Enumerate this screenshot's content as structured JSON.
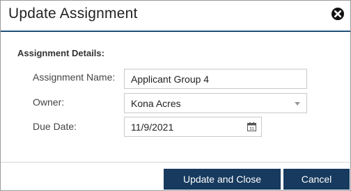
{
  "dialog": {
    "title": "Update Assignment"
  },
  "form": {
    "section_label": "Assignment Details:",
    "name_label": "Assignment Name:",
    "name_value": "Applicant Group 4",
    "owner_label": "Owner:",
    "owner_value": "Kona Acres",
    "due_label": "Due Date:",
    "due_value": "11/9/2021",
    "calendar_day": "31"
  },
  "buttons": {
    "update_close": "Update and Close",
    "cancel": "Cancel"
  },
  "colors": {
    "primary": "#173a5e",
    "header_rule": "#1e4f7a"
  }
}
